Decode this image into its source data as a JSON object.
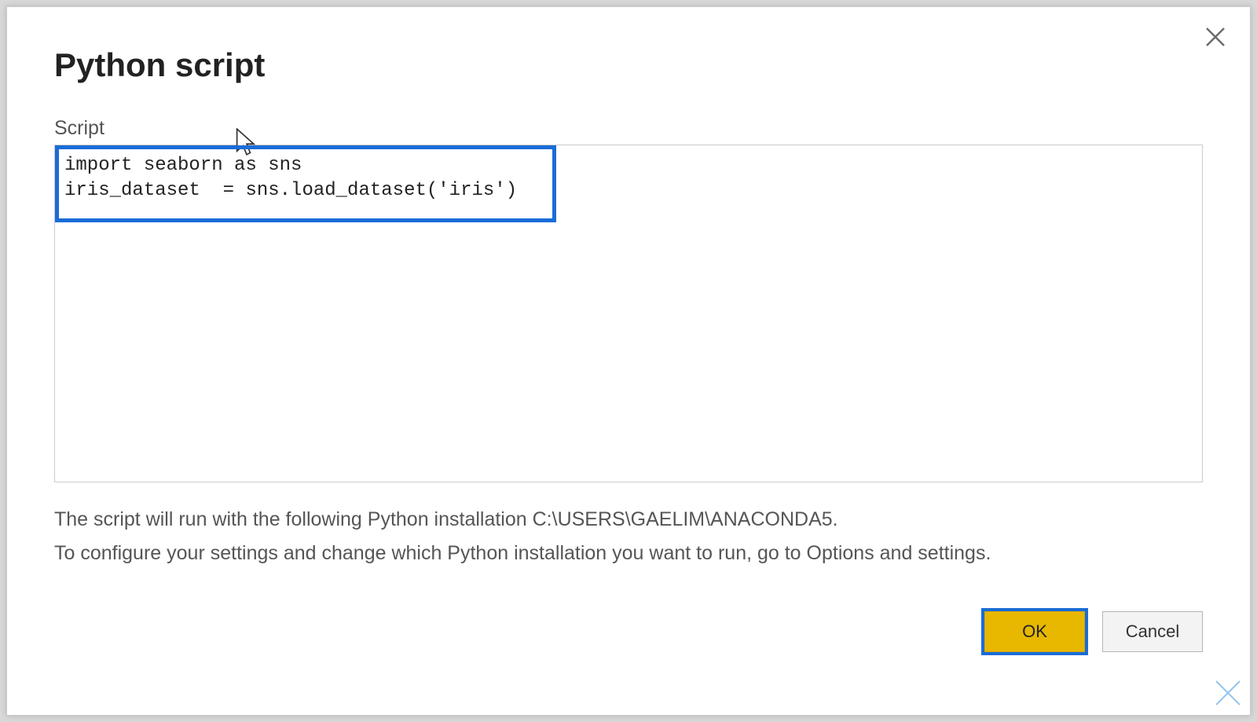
{
  "dialog": {
    "title": "Python script",
    "close_tooltip": "Close"
  },
  "script": {
    "label": "Script",
    "content": "import seaborn as sns\niris_dataset  = sns.load_dataset('iris')"
  },
  "helper": {
    "line1": "The script will run with the following Python installation C:\\USERS\\GAELIM\\ANACONDA5.",
    "line2": "To configure your settings and change which Python installation you want to run, go to Options and settings."
  },
  "buttons": {
    "ok": "OK",
    "cancel": "Cancel"
  }
}
